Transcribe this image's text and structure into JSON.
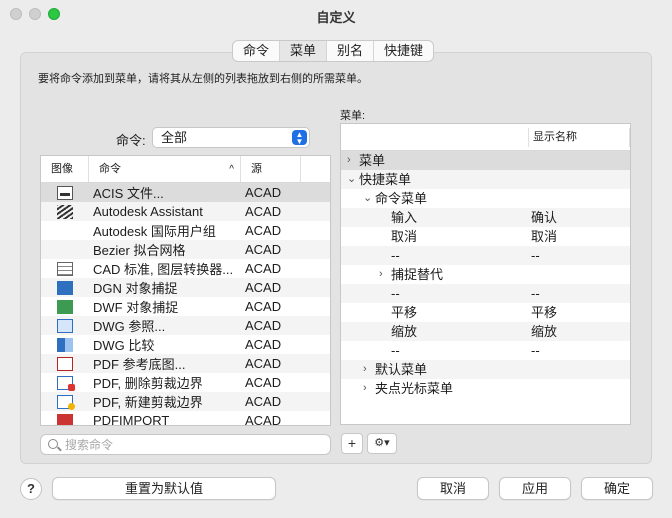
{
  "window": {
    "title": "自定义"
  },
  "tabs": [
    {
      "label": "命令",
      "active": false
    },
    {
      "label": "菜单",
      "active": true
    },
    {
      "label": "别名",
      "active": false
    },
    {
      "label": "快捷键",
      "active": false
    }
  ],
  "instruction": "要将命令添加到菜单，请将其从左侧的列表拖放到右侧的所需菜单。",
  "filter": {
    "label": "命令:",
    "value": "全部"
  },
  "command_table": {
    "headers": {
      "icon": "图像",
      "name": "命令",
      "source": "源"
    },
    "rows": [
      {
        "icon": "file-icon",
        "name": "ACIS 文件...",
        "source": "ACAD",
        "selected": true
      },
      {
        "icon": "stripes-icon",
        "name": "Autodesk Assistant",
        "source": "ACAD"
      },
      {
        "icon": "",
        "name": "Autodesk 国际用户组",
        "source": "ACAD"
      },
      {
        "icon": "",
        "name": "Bezier 拟合网格",
        "source": "ACAD"
      },
      {
        "icon": "layer-icon",
        "name": "CAD 标准, 图层转换器...",
        "source": "ACAD"
      },
      {
        "icon": "dgn-icon",
        "name": "DGN 对象捕捉",
        "source": "ACAD"
      },
      {
        "icon": "dwf-icon",
        "name": "DWF 对象捕捉",
        "source": "ACAD"
      },
      {
        "icon": "dwg-ref-icon",
        "name": "DWG 参照...",
        "source": "ACAD"
      },
      {
        "icon": "dwg-compare-icon",
        "name": "DWG 比较",
        "source": "ACAD"
      },
      {
        "icon": "pdf-icon",
        "name": "PDF 参考底图...",
        "source": "ACAD"
      },
      {
        "icon": "pdf-delete-clip-icon",
        "name": "PDF, 删除剪裁边界",
        "source": "ACAD"
      },
      {
        "icon": "pdf-new-clip-icon",
        "name": "PDF, 新建剪裁边界",
        "source": "ACAD"
      },
      {
        "icon": "pdf-import-icon",
        "name": "PDFIMPORT",
        "source": "ACAD"
      }
    ]
  },
  "search": {
    "placeholder": "搜索命令",
    "value": ""
  },
  "menu_tree": {
    "label": "菜单:",
    "header_display": "显示名称",
    "rows": [
      {
        "level": 0,
        "chevron": "›",
        "label": "菜单",
        "display": "",
        "selected": true
      },
      {
        "level": 0,
        "chevron": "⌄",
        "label": "快捷菜单",
        "display": ""
      },
      {
        "level": 1,
        "chevron": "⌄",
        "label": "命令菜单",
        "display": ""
      },
      {
        "level": 2,
        "chevron": "",
        "label": "输入",
        "display": "确认"
      },
      {
        "level": 2,
        "chevron": "",
        "label": "取消",
        "display": "取消"
      },
      {
        "level": 2,
        "chevron": "",
        "label": "--",
        "display": "--"
      },
      {
        "level": 2,
        "chevron": "›",
        "label": "捕捉替代",
        "display": ""
      },
      {
        "level": 2,
        "chevron": "",
        "label": "--",
        "display": "--"
      },
      {
        "level": 2,
        "chevron": "",
        "label": "平移",
        "display": "平移"
      },
      {
        "level": 2,
        "chevron": "",
        "label": "缩放",
        "display": "缩放"
      },
      {
        "level": 2,
        "chevron": "",
        "label": "--",
        "display": "--"
      },
      {
        "level": 1,
        "chevron": "›",
        "label": "默认菜单",
        "display": ""
      },
      {
        "level": 1,
        "chevron": "›",
        "label": "夹点光标菜单",
        "display": ""
      }
    ]
  },
  "menu_tools": {
    "add": "+",
    "gear": "⚙▾"
  },
  "footer": {
    "help": "?",
    "reset": "重置为默认值",
    "cancel": "取消",
    "apply": "应用",
    "ok": "确定"
  }
}
